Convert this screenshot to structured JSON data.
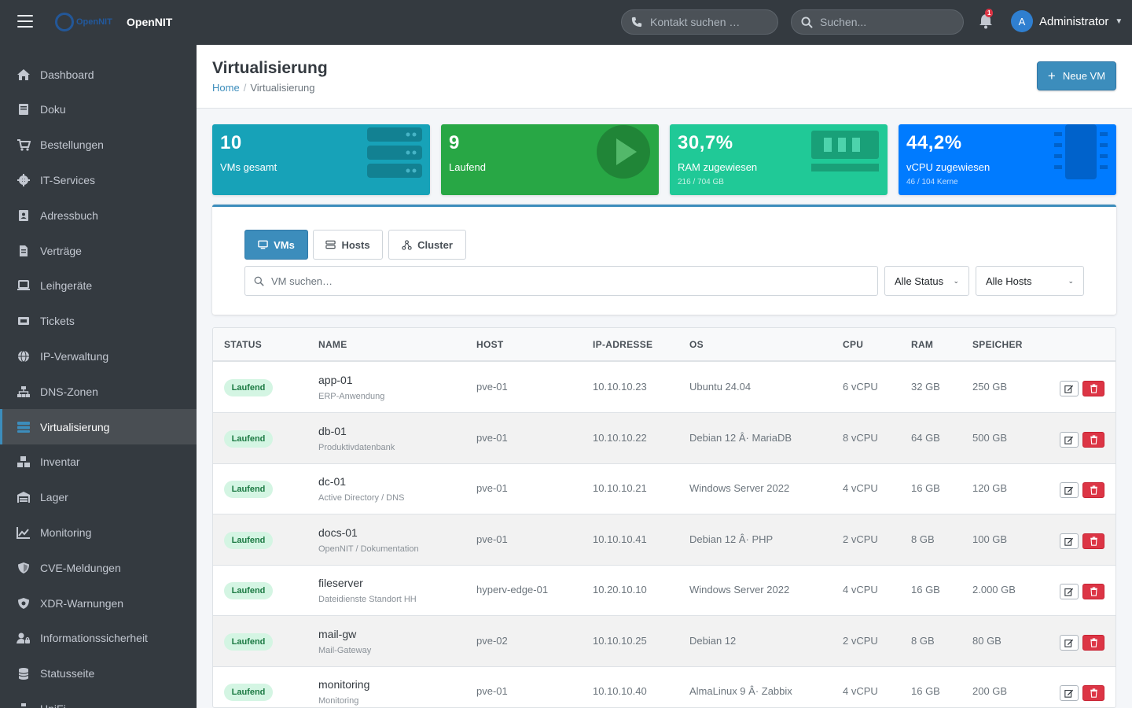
{
  "topbar": {
    "logo_text": "OpenNIT",
    "brand_name": "OpenNIT",
    "contact_search_placeholder": "Kontakt suchen …",
    "search_placeholder": "Suchen...",
    "notification_count": "1",
    "user_initial": "A",
    "user_name": "Administrator"
  },
  "sidebar": {
    "items": [
      {
        "label": "Dashboard",
        "icon": "home-icon"
      },
      {
        "label": "Doku",
        "icon": "book-icon"
      },
      {
        "label": "Bestellungen",
        "icon": "cart-icon"
      },
      {
        "label": "IT-Services",
        "icon": "gear-icon"
      },
      {
        "label": "Adressbuch",
        "icon": "address-book-icon"
      },
      {
        "label": "Verträge",
        "icon": "contract-icon"
      },
      {
        "label": "Leihgeräte",
        "icon": "laptop-icon"
      },
      {
        "label": "Tickets",
        "icon": "tickets-icon"
      },
      {
        "label": "IP-Verwaltung",
        "icon": "globe-icon"
      },
      {
        "label": "DNS-Zonen",
        "icon": "sitemap-icon"
      },
      {
        "label": "Virtualisierung",
        "icon": "server-icon",
        "active": true
      },
      {
        "label": "Inventar",
        "icon": "boxes-icon"
      },
      {
        "label": "Lager",
        "icon": "warehouse-icon"
      },
      {
        "label": "Monitoring",
        "icon": "chart-line-icon"
      },
      {
        "label": "CVE-Meldungen",
        "icon": "shield-icon"
      },
      {
        "label": "XDR-Warnungen",
        "icon": "shield-virus-icon"
      },
      {
        "label": "Informationssicherheit",
        "icon": "user-lock-icon"
      },
      {
        "label": "Statusseite",
        "icon": "database-icon"
      },
      {
        "label": "UniFi",
        "icon": "network-icon"
      }
    ]
  },
  "header": {
    "title": "Virtualisierung",
    "breadcrumb_home": "Home",
    "breadcrumb_current": "Virtualisierung",
    "new_vm_label": "Neue VM"
  },
  "stats": [
    {
      "value": "10",
      "label": "VMs gesamt",
      "sub": "",
      "color": "#17a2b8",
      "icon": "server-stack-icon"
    },
    {
      "value": "9",
      "label": "Laufend",
      "sub": "",
      "color": "#28a745",
      "icon": "play-circle-icon"
    },
    {
      "value": "30,7%",
      "label": "RAM zugewiesen",
      "sub": "216 / 704 GB",
      "color": "#20c997",
      "icon": "memory-icon"
    },
    {
      "value": "44,2%",
      "label": "vCPU zugewiesen",
      "sub": "46 / 104 Kerne",
      "color": "#007bff",
      "icon": "cpu-icon"
    }
  ],
  "filters": {
    "tabs": [
      {
        "label": "VMs",
        "active": true,
        "icon": "monitor-icon"
      },
      {
        "label": "Hosts",
        "active": false,
        "icon": "server-icon"
      },
      {
        "label": "Cluster",
        "active": false,
        "icon": "cluster-icon"
      }
    ],
    "search_placeholder": "VM suchen…",
    "status_select": "Alle Status",
    "hosts_select": "Alle Hosts"
  },
  "table": {
    "columns": [
      "STATUS",
      "NAME",
      "HOST",
      "IP-ADRESSE",
      "OS",
      "CPU",
      "RAM",
      "SPEICHER"
    ],
    "rows": [
      {
        "status": "Laufend",
        "name": "app-01",
        "desc": "ERP-Anwendung",
        "host": "pve-01",
        "ip": "10.10.10.23",
        "os": "Ubuntu 24.04",
        "cpu": "6 vCPU",
        "ram": "32 GB",
        "storage": "250 GB"
      },
      {
        "status": "Laufend",
        "name": "db-01",
        "desc": "Produktivdatenbank",
        "host": "pve-01",
        "ip": "10.10.10.22",
        "os": "Debian 12 Â· MariaDB",
        "cpu": "8 vCPU",
        "ram": "64 GB",
        "storage": "500 GB"
      },
      {
        "status": "Laufend",
        "name": "dc-01",
        "desc": "Active Directory / DNS",
        "host": "pve-01",
        "ip": "10.10.10.21",
        "os": "Windows Server 2022",
        "cpu": "4 vCPU",
        "ram": "16 GB",
        "storage": "120 GB"
      },
      {
        "status": "Laufend",
        "name": "docs-01",
        "desc": "OpenNIT / Dokumentation",
        "host": "pve-01",
        "ip": "10.10.10.41",
        "os": "Debian 12 Â· PHP",
        "cpu": "2 vCPU",
        "ram": "8 GB",
        "storage": "100 GB"
      },
      {
        "status": "Laufend",
        "name": "fileserver",
        "desc": "Dateidienste Standort HH",
        "host": "hyperv-edge-01",
        "ip": "10.20.10.10",
        "os": "Windows Server 2022",
        "cpu": "4 vCPU",
        "ram": "16 GB",
        "storage": "2.000 GB"
      },
      {
        "status": "Laufend",
        "name": "mail-gw",
        "desc": "Mail-Gateway",
        "host": "pve-02",
        "ip": "10.10.10.25",
        "os": "Debian 12",
        "cpu": "2 vCPU",
        "ram": "8 GB",
        "storage": "80 GB"
      },
      {
        "status": "Laufend",
        "name": "monitoring",
        "desc": "Monitoring",
        "host": "pve-01",
        "ip": "10.10.10.40",
        "os": "AlmaLinux 9 Â· Zabbix",
        "cpu": "4 vCPU",
        "ram": "16 GB",
        "storage": "200 GB"
      }
    ]
  }
}
